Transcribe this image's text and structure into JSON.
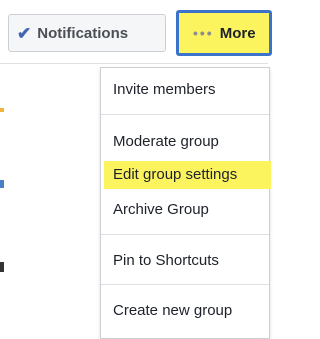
{
  "toolbar": {
    "notifications_label": "Notifications",
    "more_label": "More"
  },
  "menu": {
    "items": [
      {
        "label": "Invite members"
      },
      {
        "label": "Moderate group"
      },
      {
        "label": "Edit group settings",
        "highlighted": true
      },
      {
        "label": "Archive Group"
      },
      {
        "label": "Pin to Shortcuts"
      },
      {
        "label": "Create new group"
      }
    ]
  },
  "colors": {
    "highlight": "#fcf45f",
    "more_border": "#3a73c9",
    "check": "#4267b2"
  }
}
